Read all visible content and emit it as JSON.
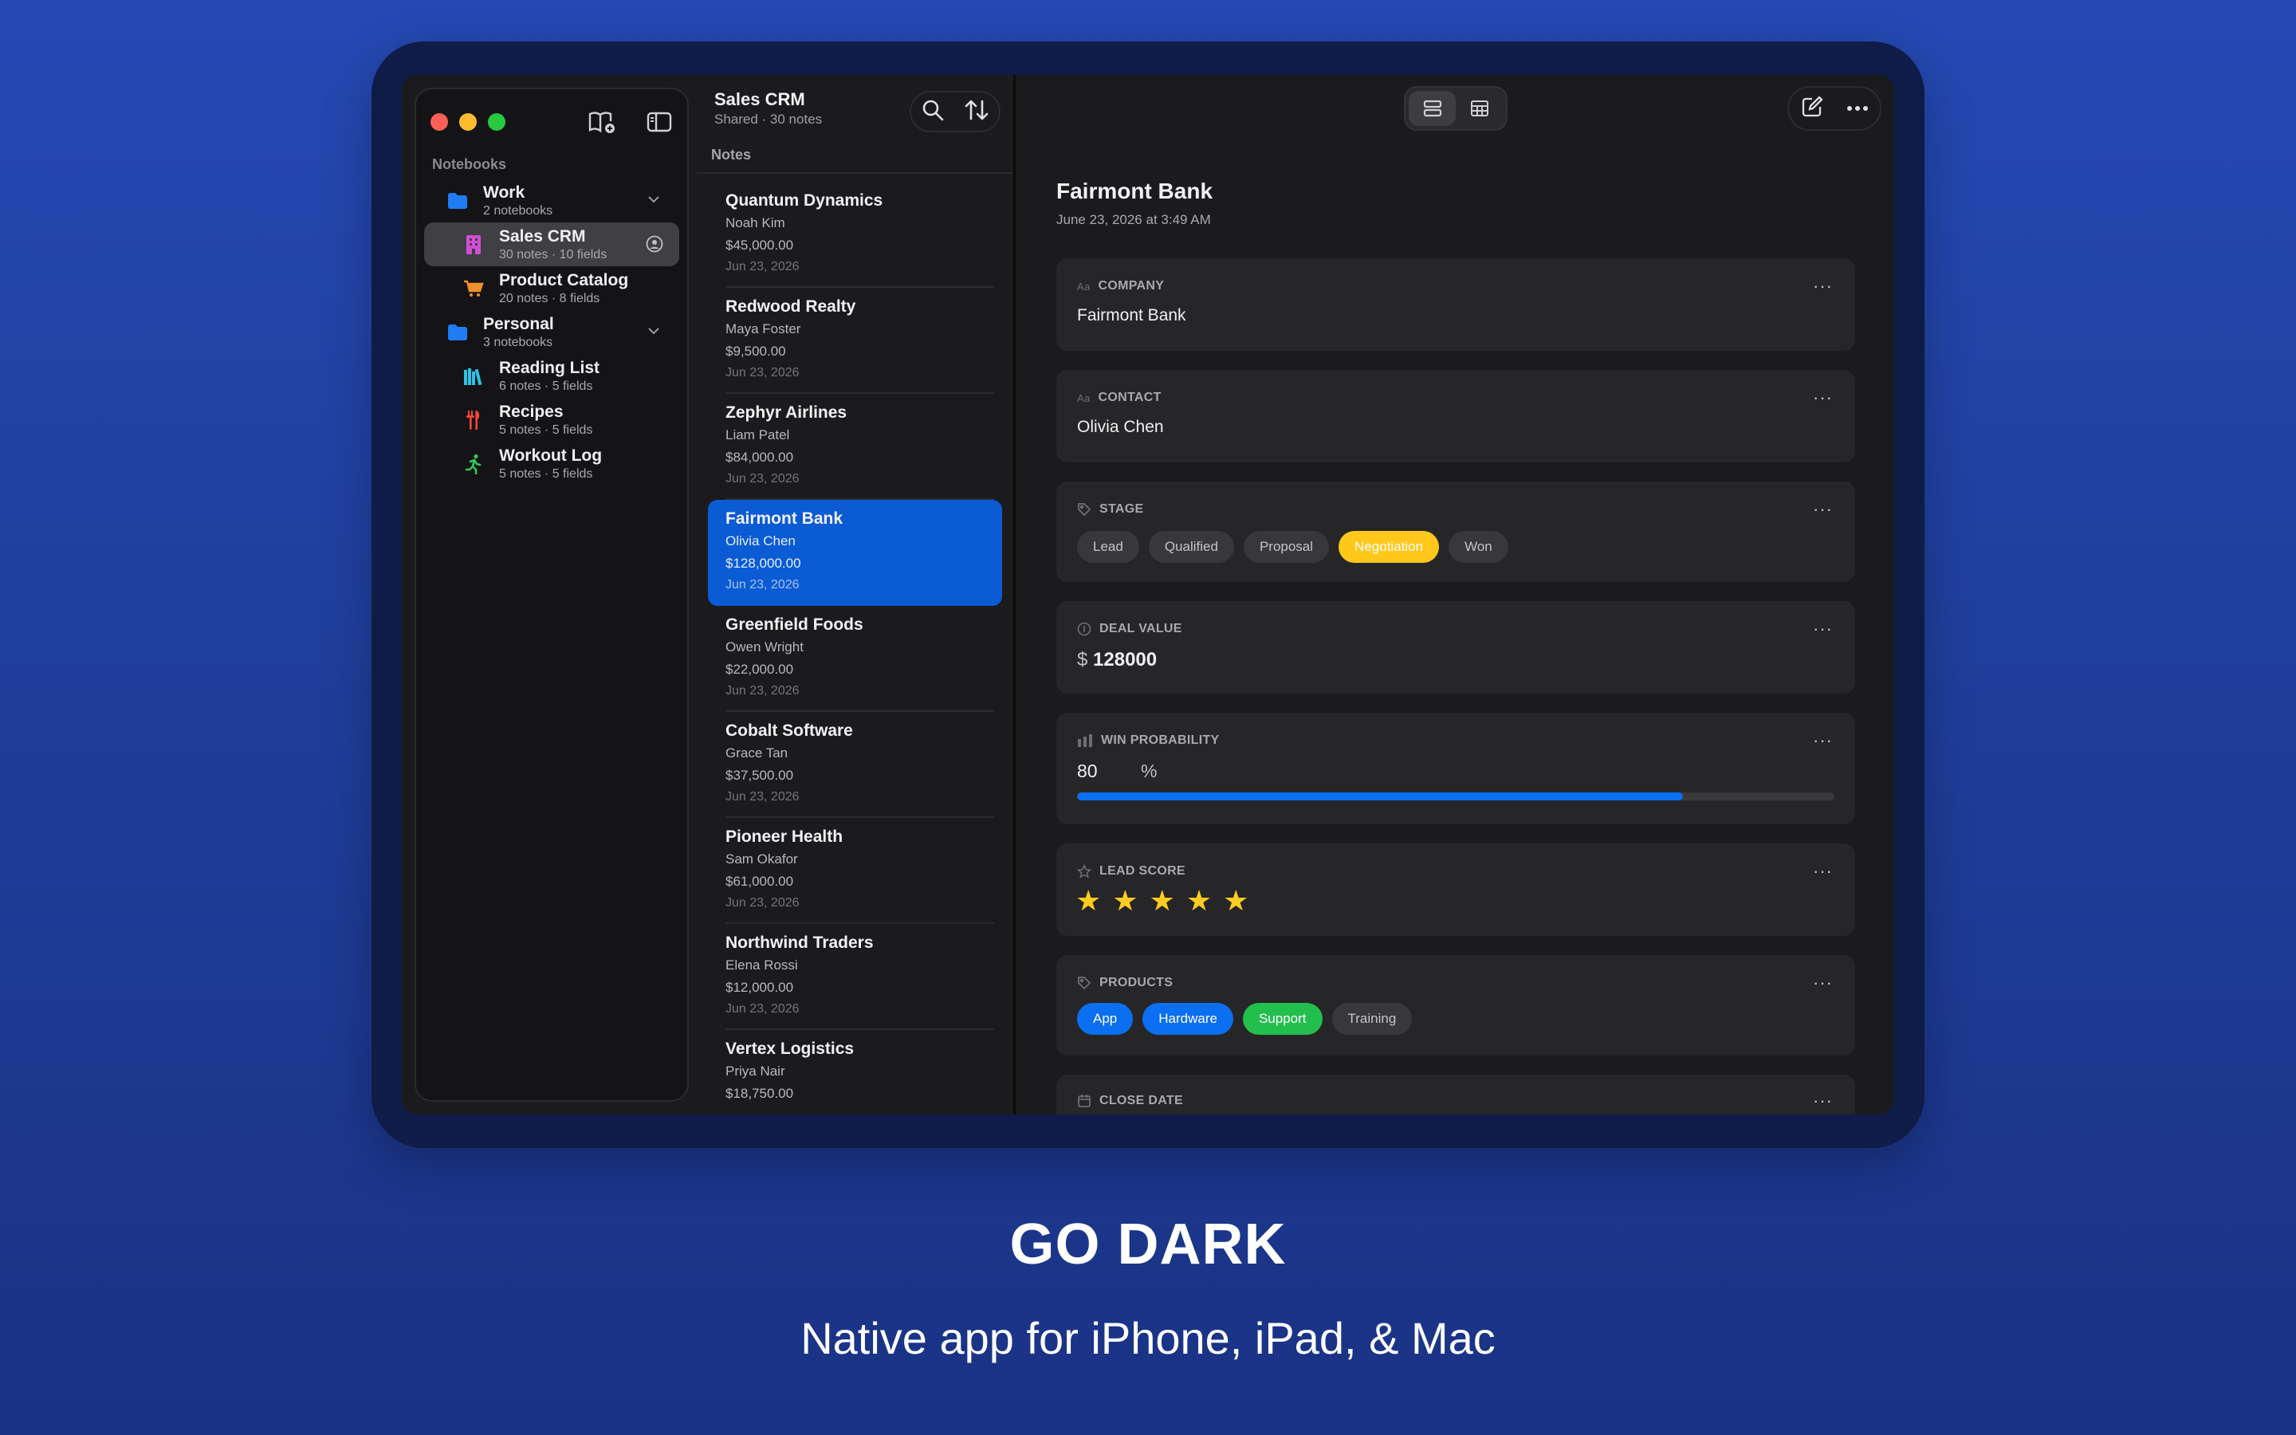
{
  "sidebar": {
    "header": "Notebooks",
    "groups": [
      {
        "title": "Work",
        "subtitle": "2 notebooks",
        "children": [
          {
            "title": "Sales CRM",
            "subtitle": "30 notes · 10 fields",
            "icon": "building-icon",
            "selected": true
          },
          {
            "title": "Product Catalog",
            "subtitle": "20 notes · 8 fields",
            "icon": "cart-icon"
          }
        ]
      },
      {
        "title": "Personal",
        "subtitle": "3 notebooks",
        "children": [
          {
            "title": "Reading List",
            "subtitle": "6 notes · 5 fields",
            "icon": "books-icon"
          },
          {
            "title": "Recipes",
            "subtitle": "5 notes · 5 fields",
            "icon": "fork-knife-icon"
          },
          {
            "title": "Workout Log",
            "subtitle": "5 notes · 5 fields",
            "icon": "runner-icon"
          }
        ]
      }
    ]
  },
  "notes_list": {
    "title": "Sales CRM",
    "subtitle": "Shared · 30 notes",
    "section": "Notes",
    "items": [
      {
        "company": "Quantum Dynamics",
        "contact": "Noah Kim",
        "value": "$45,000.00",
        "date": "Jun 23, 2026"
      },
      {
        "company": "Redwood Realty",
        "contact": "Maya Foster",
        "value": "$9,500.00",
        "date": "Jun 23, 2026"
      },
      {
        "company": "Zephyr Airlines",
        "contact": "Liam Patel",
        "value": "$84,000.00",
        "date": "Jun 23, 2026"
      },
      {
        "company": "Fairmont Bank",
        "contact": "Olivia Chen",
        "value": "$128,000.00",
        "date": "Jun 23, 2026",
        "active": true
      },
      {
        "company": "Greenfield Foods",
        "contact": "Owen Wright",
        "value": "$22,000.00",
        "date": "Jun 23, 2026"
      },
      {
        "company": "Cobalt Software",
        "contact": "Grace Tan",
        "value": "$37,500.00",
        "date": "Jun 23, 2026"
      },
      {
        "company": "Pioneer Health",
        "contact": "Sam Okafor",
        "value": "$61,000.00",
        "date": "Jun 23, 2026"
      },
      {
        "company": "Northwind Traders",
        "contact": "Elena Rossi",
        "value": "$12,000.00",
        "date": "Jun 23, 2026"
      },
      {
        "company": "Vertex Logistics",
        "contact": "Priya Nair",
        "value": "$18,750.00",
        "date": ""
      }
    ]
  },
  "detail": {
    "title": "Fairmont Bank",
    "timestamp": "June 23, 2026 at 3:49 AM",
    "more_label": "···",
    "company": {
      "label": "COMPANY",
      "type_icon": "Aa",
      "value": "Fairmont Bank"
    },
    "contact": {
      "label": "CONTACT",
      "type_icon": "Aa",
      "value": "Olivia Chen"
    },
    "stage": {
      "label": "STAGE",
      "options": [
        "Lead",
        "Qualified",
        "Proposal",
        "Negotiation",
        "Won"
      ],
      "selected": "Negotiation"
    },
    "deal_value": {
      "label": "DEAL VALUE",
      "currency": "$",
      "value": "128000"
    },
    "win_probability": {
      "label": "WIN PROBABILITY",
      "value": "80",
      "unit": "%",
      "fraction": 0.8
    },
    "lead_score": {
      "label": "LEAD SCORE",
      "rating": 5,
      "max": 5
    },
    "products": {
      "label": "PRODUCTS",
      "options": [
        "App",
        "Hardware",
        "Support",
        "Training"
      ],
      "selected": [
        "App",
        "Hardware",
        "Support"
      ]
    },
    "close_date": {
      "label": "CLOSE DATE"
    }
  },
  "colors": {
    "accent": "#0a6ff0",
    "selected_note": "#0a5bd4",
    "negotiation": "#ffc81a",
    "support": "#22bf4f",
    "star": "#ffcc1f"
  },
  "promo": {
    "headline": "GO DARK",
    "subline": "Native app for iPhone, iPad, & Mac"
  }
}
